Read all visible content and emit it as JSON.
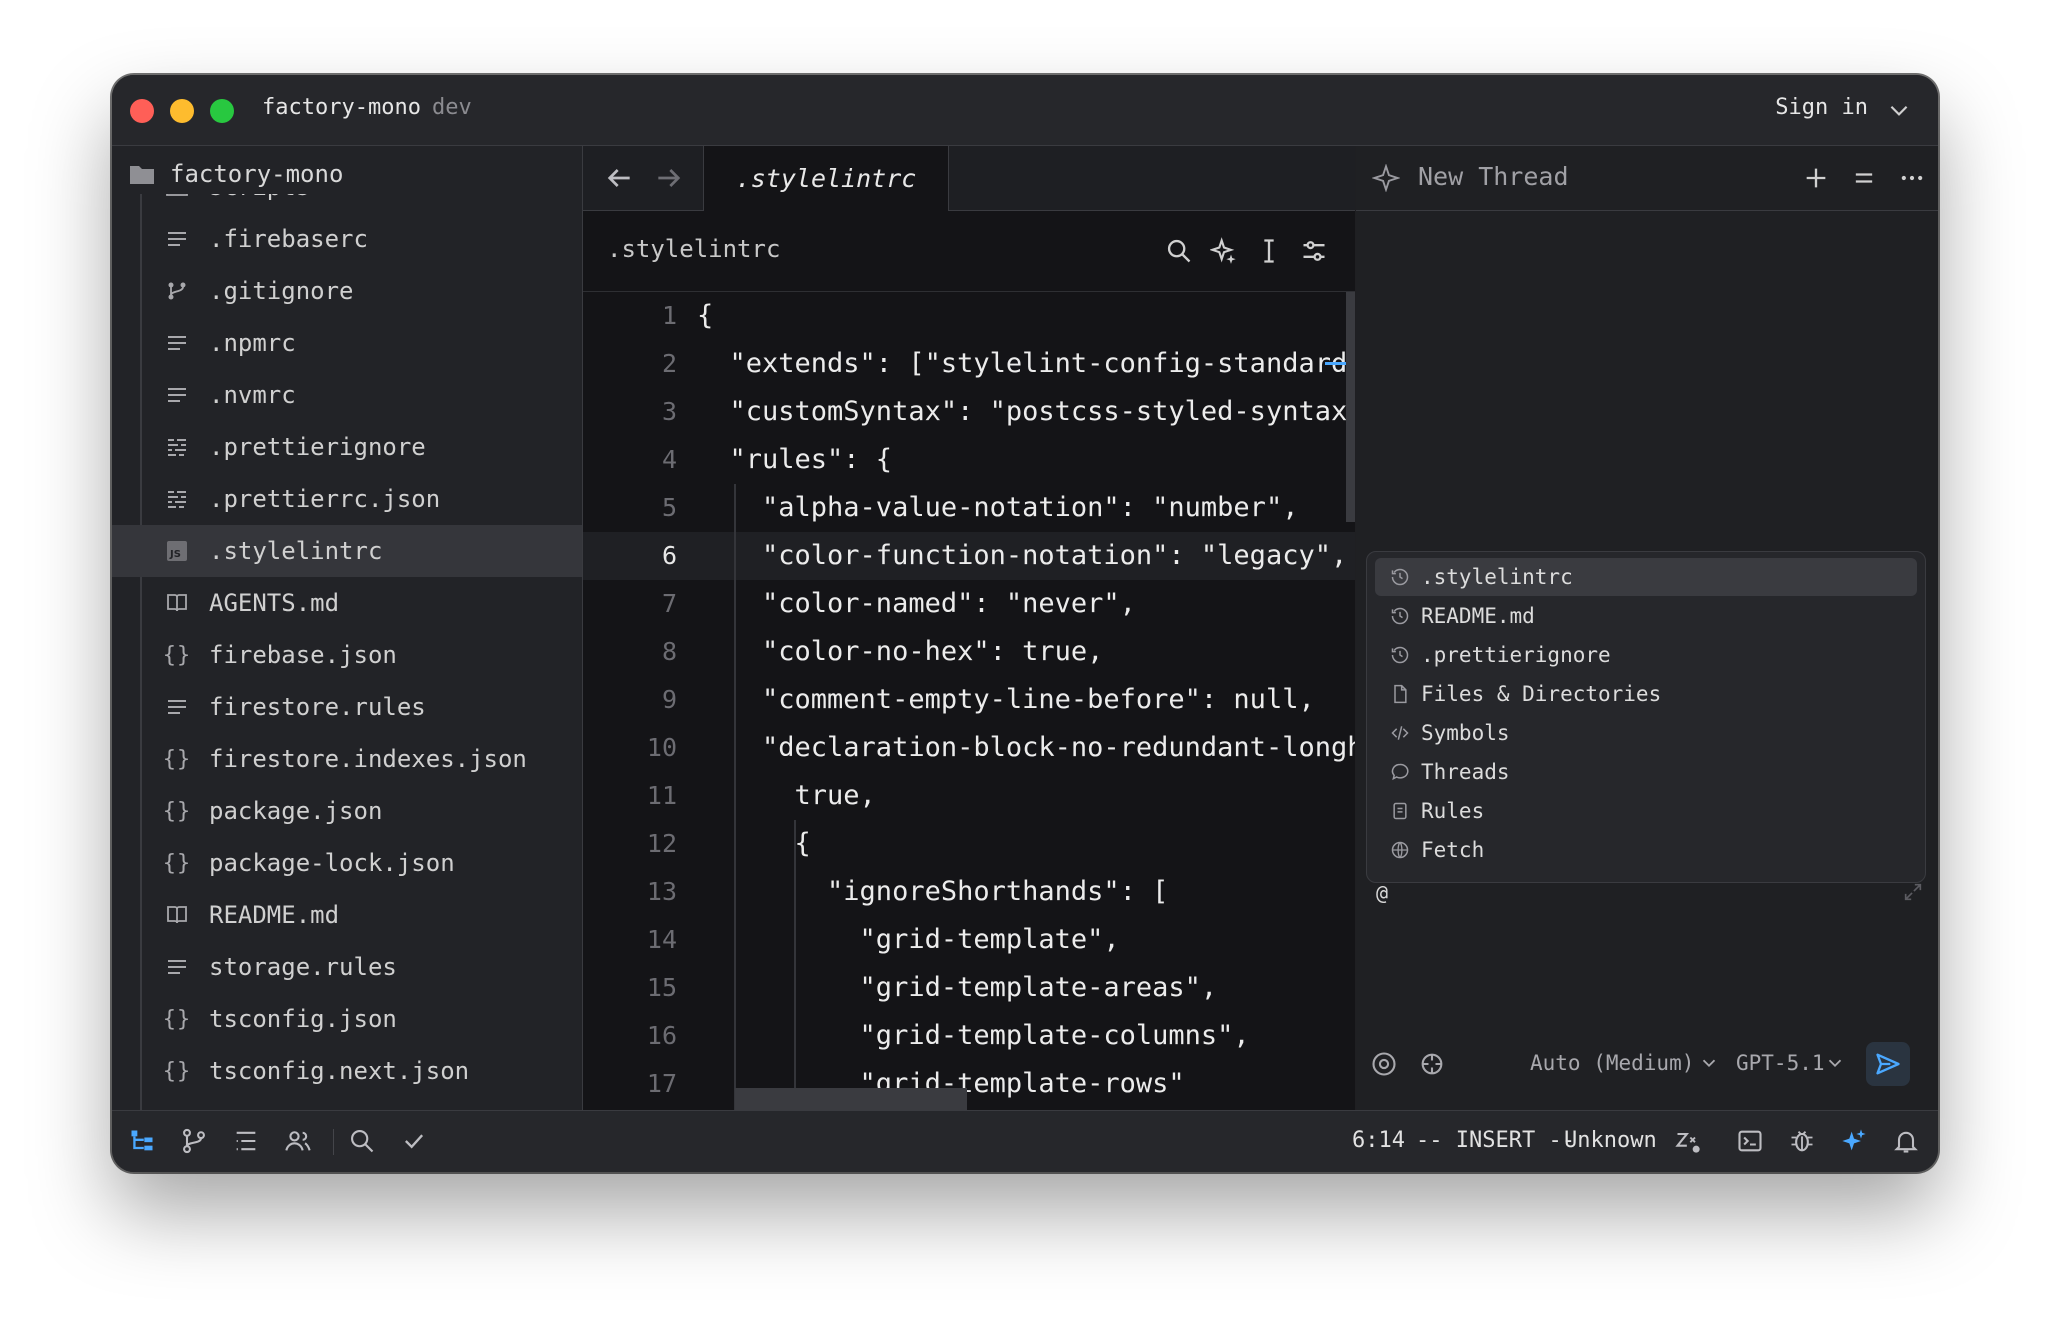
{
  "titlebar": {
    "project": "factory-mono",
    "branch": "dev",
    "sign_in": "Sign in"
  },
  "colors": {
    "close": "#ff5f57",
    "minimize": "#febc2e",
    "zoom": "#28c840",
    "accent": "#4aa8ff"
  },
  "sidebar": {
    "root": "factory-mono",
    "items": [
      {
        "label": "scripts",
        "icon": "folder-icon"
      },
      {
        "label": ".firebaserc",
        "icon": "text-file-icon"
      },
      {
        "label": ".gitignore",
        "icon": "git-icon"
      },
      {
        "label": ".npmrc",
        "icon": "text-file-icon"
      },
      {
        "label": ".nvmrc",
        "icon": "text-file-icon"
      },
      {
        "label": ".prettierignore",
        "icon": "prettier-icon"
      },
      {
        "label": ".prettierrc.json",
        "icon": "prettier-icon"
      },
      {
        "label": ".stylelintrc",
        "icon": "js-icon"
      },
      {
        "label": "AGENTS.md",
        "icon": "book-icon"
      },
      {
        "label": "firebase.json",
        "icon": "json-icon"
      },
      {
        "label": "firestore.rules",
        "icon": "text-file-icon"
      },
      {
        "label": "firestore.indexes.json",
        "icon": "json-icon"
      },
      {
        "label": "package.json",
        "icon": "json-icon"
      },
      {
        "label": "package-lock.json",
        "icon": "json-icon"
      },
      {
        "label": "README.md",
        "icon": "book-icon"
      },
      {
        "label": "storage.rules",
        "icon": "text-file-icon"
      },
      {
        "label": "tsconfig.json",
        "icon": "json-icon"
      },
      {
        "label": "tsconfig.next.json",
        "icon": "json-icon"
      }
    ]
  },
  "editor": {
    "tab": ".stylelintrc",
    "breadcrumb": ".stylelintrc",
    "current_line": 6,
    "lines": [
      {
        "n": "1",
        "text": "{"
      },
      {
        "n": "2",
        "text": "  \"extends\": [\"stylelint-config-standard\","
      },
      {
        "n": "3",
        "text": "  \"customSyntax\": \"postcss-styled-syntax\","
      },
      {
        "n": "4",
        "text": "  \"rules\": {"
      },
      {
        "n": "5",
        "text": "    \"alpha-value-notation\": \"number\","
      },
      {
        "n": "6",
        "text": "    \"color-function-notation\": \"legacy\","
      },
      {
        "n": "7",
        "text": "    \"color-named\": \"never\","
      },
      {
        "n": "8",
        "text": "    \"color-no-hex\": true,"
      },
      {
        "n": "9",
        "text": "    \"comment-empty-line-before\": null,"
      },
      {
        "n": "10",
        "text": "    \"declaration-block-no-redundant-longhand-properties\": ["
      },
      {
        "n": "11",
        "text": "      true,"
      },
      {
        "n": "12",
        "text": "      {"
      },
      {
        "n": "13",
        "text": "        \"ignoreShorthands\": ["
      },
      {
        "n": "14",
        "text": "          \"grid-template\","
      },
      {
        "n": "15",
        "text": "          \"grid-template-areas\","
      },
      {
        "n": "16",
        "text": "          \"grid-template-columns\","
      },
      {
        "n": "17",
        "text": "          \"grid-template-rows\""
      }
    ]
  },
  "thread": {
    "title": "New Thread",
    "menu": [
      {
        "label": ".stylelintrc",
        "icon": "history-icon"
      },
      {
        "label": "README.md",
        "icon": "history-icon"
      },
      {
        "label": ".prettierignore",
        "icon": "history-icon"
      },
      {
        "label": "Files & Directories",
        "icon": "file-icon"
      },
      {
        "label": "Symbols",
        "icon": "code-icon"
      },
      {
        "label": "Threads",
        "icon": "chat-icon"
      },
      {
        "label": "Rules",
        "icon": "rules-icon"
      },
      {
        "label": "Fetch",
        "icon": "globe-icon"
      }
    ],
    "input_value": "@",
    "mode": "Auto (Medium)",
    "model": "GPT-5.1"
  },
  "status": {
    "position": "6:14",
    "mode": "-- INSERT --",
    "language": "Unknown"
  }
}
